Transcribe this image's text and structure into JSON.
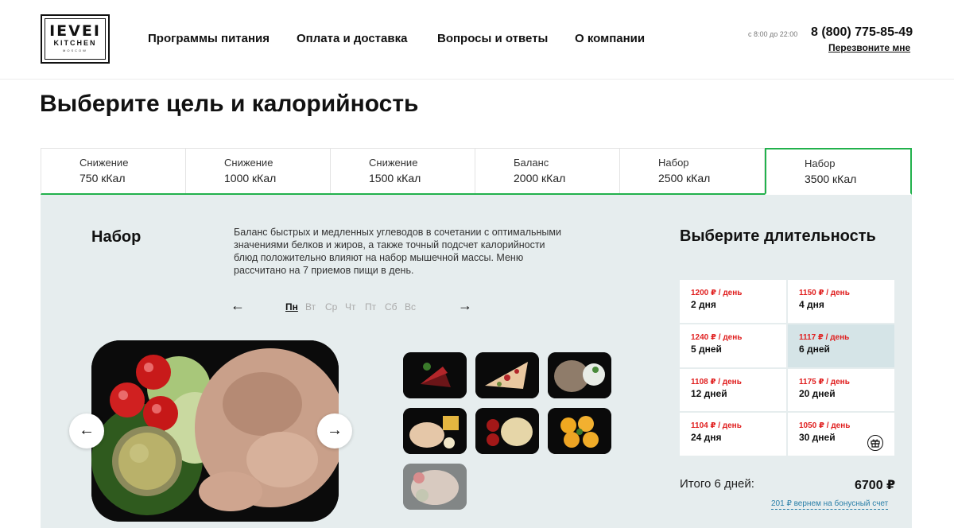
{
  "header": {
    "logo": {
      "main": "IEVEI",
      "sub": "KITCHEN",
      "city": "MOSCOW"
    },
    "nav": [
      "Программы питания",
      "Оплата и доставка",
      "Вопросы и ответы",
      "О компании"
    ],
    "hours": "с 8:00 до 22:00",
    "phone": "8 (800) 775-85-49",
    "callback": "Перезвоните мне"
  },
  "page_title": "Выберите цель и калорийность",
  "tabs": [
    {
      "goal": "Снижение",
      "kcal": "750 кКал"
    },
    {
      "goal": "Снижение",
      "kcal": "1000 кКал"
    },
    {
      "goal": "Снижение",
      "kcal": "1500 кКал"
    },
    {
      "goal": "Баланс",
      "kcal": "2000 кКал"
    },
    {
      "goal": "Набор",
      "kcal": "2500 кКал"
    },
    {
      "goal": "Набор",
      "kcal": "3500 кКал"
    }
  ],
  "active_tab": 5,
  "program": {
    "name": "Набор",
    "description": "Баланс быстрых и медленных углеводов в сочетании с оптимальными значениями белков и жиров, а также точный подсчет калорийности блюд положительно влияют на набор мышечной массы. Меню рассчитано на 7 приемов пищи в день."
  },
  "days": {
    "prev": "←",
    "next": "→",
    "items": [
      "Пн",
      "Вт",
      "Ср",
      "Чт",
      "Пт",
      "Сб",
      "Вс"
    ],
    "active": 0
  },
  "gallery": {
    "prev": "←",
    "next": "→"
  },
  "duration": {
    "title": "Выберите длительность",
    "options": [
      {
        "price": "1200 ₽ / день",
        "days": "2 дня"
      },
      {
        "price": "1150 ₽ / день",
        "days": "4 дня"
      },
      {
        "price": "1240 ₽ / день",
        "days": "5 дней"
      },
      {
        "price": "1117 ₽ / день",
        "days": "6 дней"
      },
      {
        "price": "1108 ₽ / день",
        "days": "12 дней"
      },
      {
        "price": "1175 ₽ / день",
        "days": "20 дней"
      },
      {
        "price": "1104 ₽ / день",
        "days": "24 дня"
      },
      {
        "price": "1050 ₽ / день",
        "days": "30 дней"
      }
    ],
    "selected": 3
  },
  "total": {
    "label": "Итого 6 дней:",
    "value": "6700 ₽",
    "bonus": "201 ₽ вернем на бонусный счет"
  },
  "colors": {
    "accent": "#22b14c",
    "price": "#e01f1f",
    "panel": "#e6edee",
    "link": "#2a7fa8"
  }
}
